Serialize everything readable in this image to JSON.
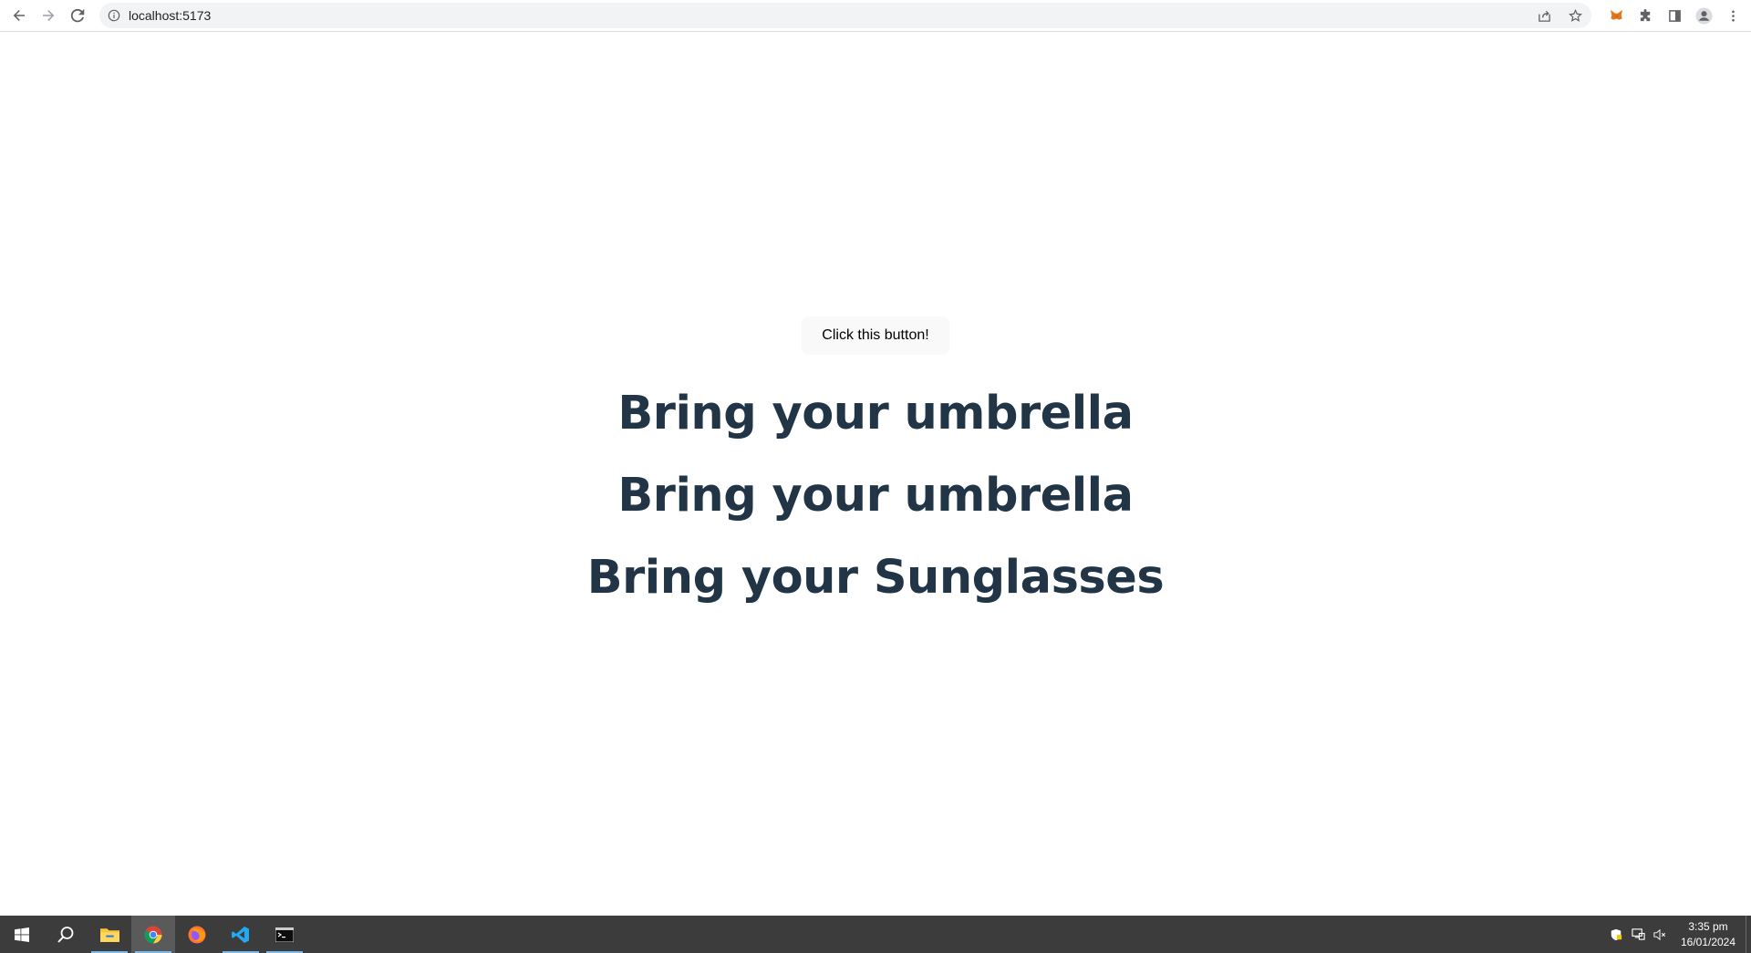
{
  "browser": {
    "url": "localhost:5173"
  },
  "page": {
    "button_label": "Click this button!",
    "messages": [
      "Bring your umbrella",
      "Bring your umbrella",
      "Bring your Sunglasses"
    ]
  },
  "taskbar": {
    "apps": [
      "start-icon",
      "search-icon",
      "file-explorer-icon",
      "chrome-icon",
      "firefox-icon",
      "vscode-icon",
      "terminal-icon"
    ],
    "clock_time": "3:35 pm",
    "clock_date": "16/01/2024"
  },
  "colors": {
    "heading": "#213547",
    "taskbar": "#3c3c3c",
    "button_bg": "#f9f9f9"
  }
}
